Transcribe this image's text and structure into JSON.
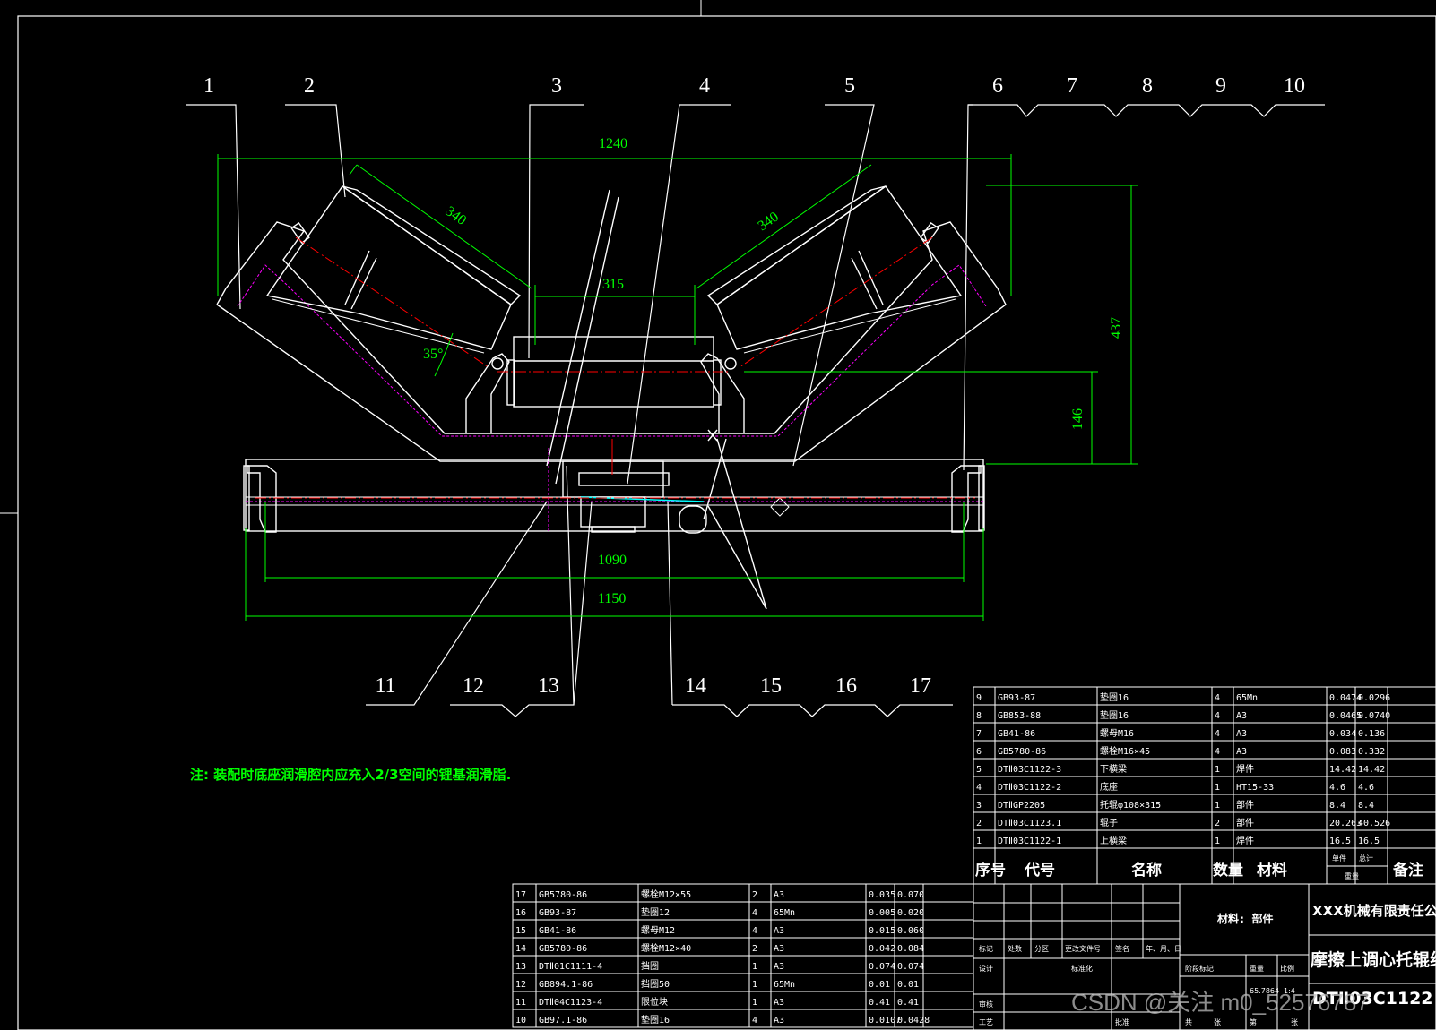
{
  "callouts": {
    "top": [
      "1",
      "2",
      "3",
      "4",
      "5",
      "6",
      "7",
      "8",
      "9",
      "10"
    ],
    "bottom": [
      "11",
      "12",
      "13",
      "14",
      "15",
      "16",
      "17"
    ]
  },
  "dimensions": {
    "width_total": "1240",
    "roller_length_left": "340",
    "roller_length_right": "340",
    "center_width": "315",
    "height_total": "437",
    "height_lower": "146",
    "trough_angle": "35°",
    "base_width_inner": "1090",
    "base_width_outer": "1150"
  },
  "note": "注: 装配时底座润滑腔内应充入2/3空间的锂基润滑脂.",
  "bom_right": {
    "rows": [
      {
        "no": "9",
        "code": "GB93-87",
        "name": "垫圈16",
        "qty": "4",
        "mat": "65Mn",
        "w1": "0.0474",
        "w2": "0.0296"
      },
      {
        "no": "8",
        "code": "GB853-88",
        "name": "垫圈16",
        "qty": "4",
        "mat": "A3",
        "w1": "0.0465",
        "w2": "0.0740"
      },
      {
        "no": "7",
        "code": "GB41-86",
        "name": "螺母M16",
        "qty": "4",
        "mat": "A3",
        "w1": "0.034",
        "w2": "0.136"
      },
      {
        "no": "6",
        "code": "GB5780-86",
        "name": "螺栓M16×45",
        "qty": "4",
        "mat": "A3",
        "w1": "0.083",
        "w2": "0.332"
      },
      {
        "no": "5",
        "code": "DTⅡ03C1122-3",
        "name": "下横梁",
        "qty": "1",
        "mat": "焊件",
        "w1": "14.42",
        "w2": "14.42"
      },
      {
        "no": "4",
        "code": "DTⅡ03C1122-2",
        "name": "底座",
        "qty": "1",
        "mat": "HT15-33",
        "w1": "4.6",
        "w2": "4.6"
      },
      {
        "no": "3",
        "code": "DTⅡGP2205",
        "name": "托辊φ108×315",
        "qty": "1",
        "mat": "部件",
        "w1": "8.4",
        "w2": "8.4"
      },
      {
        "no": "2",
        "code": "DTⅡ03C1123.1",
        "name": "辊子",
        "qty": "2",
        "mat": "部件",
        "w1": "20.263",
        "w2": "40.526"
      },
      {
        "no": "1",
        "code": "DTⅡ03C1122-1",
        "name": "上横梁",
        "qty": "1",
        "mat": "焊件",
        "w1": "16.5",
        "w2": "16.5"
      }
    ],
    "header": {
      "no": "序号",
      "code": "代号",
      "name": "名称",
      "qty": "数量",
      "mat": "材料",
      "w1": "单件",
      "w2": "总计",
      "weight": "重量",
      "remark": "备注"
    }
  },
  "bom_left": {
    "rows": [
      {
        "no": "17",
        "code": "GB5780-86",
        "name": "螺栓M12×55",
        "qty": "2",
        "mat": "A3",
        "w1": "0.035",
        "w2": "0.070"
      },
      {
        "no": "16",
        "code": "GB93-87",
        "name": "垫圈12",
        "qty": "4",
        "mat": "65Mn",
        "w1": "0.005",
        "w2": "0.020"
      },
      {
        "no": "15",
        "code": "GB41-86",
        "name": "螺母M12",
        "qty": "4",
        "mat": "A3",
        "w1": "0.015",
        "w2": "0.060"
      },
      {
        "no": "14",
        "code": "GB5780-86",
        "name": "螺栓M12×40",
        "qty": "2",
        "mat": "A3",
        "w1": "0.042",
        "w2": "0.084"
      },
      {
        "no": "13",
        "code": "DTⅡ01C1111-4",
        "name": "挡圈",
        "qty": "1",
        "mat": "A3",
        "w1": "0.074",
        "w2": "0.074"
      },
      {
        "no": "12",
        "code": "GB894.1-86",
        "name": "挡圈50",
        "qty": "1",
        "mat": "65Mn",
        "w1": "0.01",
        "w2": "0.01"
      },
      {
        "no": "11",
        "code": "DTⅡ04C1123-4",
        "name": "限位块",
        "qty": "1",
        "mat": "A3",
        "w1": "0.41",
        "w2": "0.41"
      },
      {
        "no": "10",
        "code": "GB97.1-86",
        "name": "垫圈16",
        "qty": "4",
        "mat": "A3",
        "w1": "0.0107",
        "w2": "0.0428"
      }
    ]
  },
  "title_block": {
    "material": "材料: 部件",
    "company": "XXX机械有限责任公司",
    "drawing_name": "摩擦上调心托辊组",
    "drawing_no": "DTⅡ03C1122",
    "weight": "65.7864",
    "scale": "1:4",
    "labels": [
      "标记",
      "处数",
      "分区",
      "更改文件号",
      "签名",
      "年、月、日",
      "设计",
      "标准化",
      "审核",
      "工艺",
      "批准",
      "阶段标记",
      "重量",
      "比例",
      "共",
      "张",
      "第",
      "张"
    ]
  },
  "watermark": "CSDN @关注 m0_52576787",
  "colors": {
    "line": "#ffffff",
    "dim": "#00ff00",
    "center": "#ff0000",
    "hidden": "#ff00ff",
    "bg": "#000000"
  }
}
